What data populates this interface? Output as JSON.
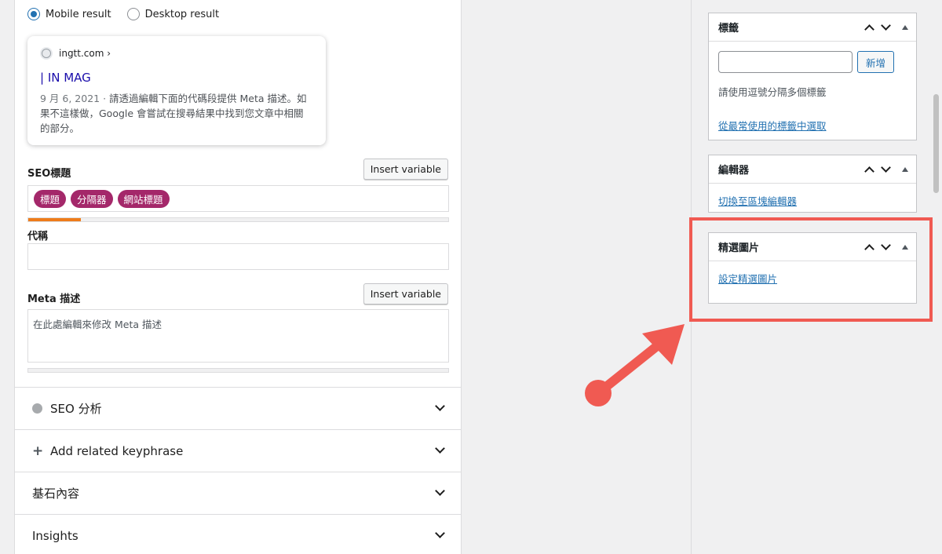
{
  "preview": {
    "mobile_label": "Mobile result",
    "desktop_label": "Desktop result",
    "selected": "mobile",
    "url": "ingtt.com ›",
    "title": "| IN MAG",
    "date": "9 月 6, 2021 ·",
    "description": " 請透過編輯下面的代碼段提供 Meta 描述。如果不這樣做，Google 會嘗試在搜尋結果中找到您文章中相關的部分。"
  },
  "seo_title": {
    "label": "SEO標題",
    "insert_button": "Insert variable",
    "pills": [
      "標題",
      "分隔器",
      "網站標題"
    ],
    "progress": 0.125
  },
  "slug": {
    "label": "代稱",
    "value": ""
  },
  "meta": {
    "label": "Meta 描述",
    "insert_button": "Insert variable",
    "placeholder": "在此處編輯來修改 Meta 描述"
  },
  "accordions": [
    {
      "label": "SEO 分析",
      "lead": "circle-icon"
    },
    {
      "label": "Add related keyphrase",
      "lead": "plus-icon"
    },
    {
      "label": "基石內容",
      "lead": ""
    },
    {
      "label": "Insights",
      "lead": ""
    }
  ],
  "sidebar": {
    "tags_box": {
      "title": "標籤",
      "add_button": "新增",
      "hint": "請使用逗號分隔多個標籤",
      "link": "從最常使用的標籤中選取"
    },
    "editor_box": {
      "title": "編輯器",
      "link": "切換至區塊編輯器"
    },
    "featured_box": {
      "title": "精選圖片",
      "link": "設定精選圖片"
    }
  },
  "colors": {
    "pill": "#a4286a",
    "progress": "#ee7c1b",
    "link": "#2271b1",
    "highlight": "#f05a52"
  }
}
